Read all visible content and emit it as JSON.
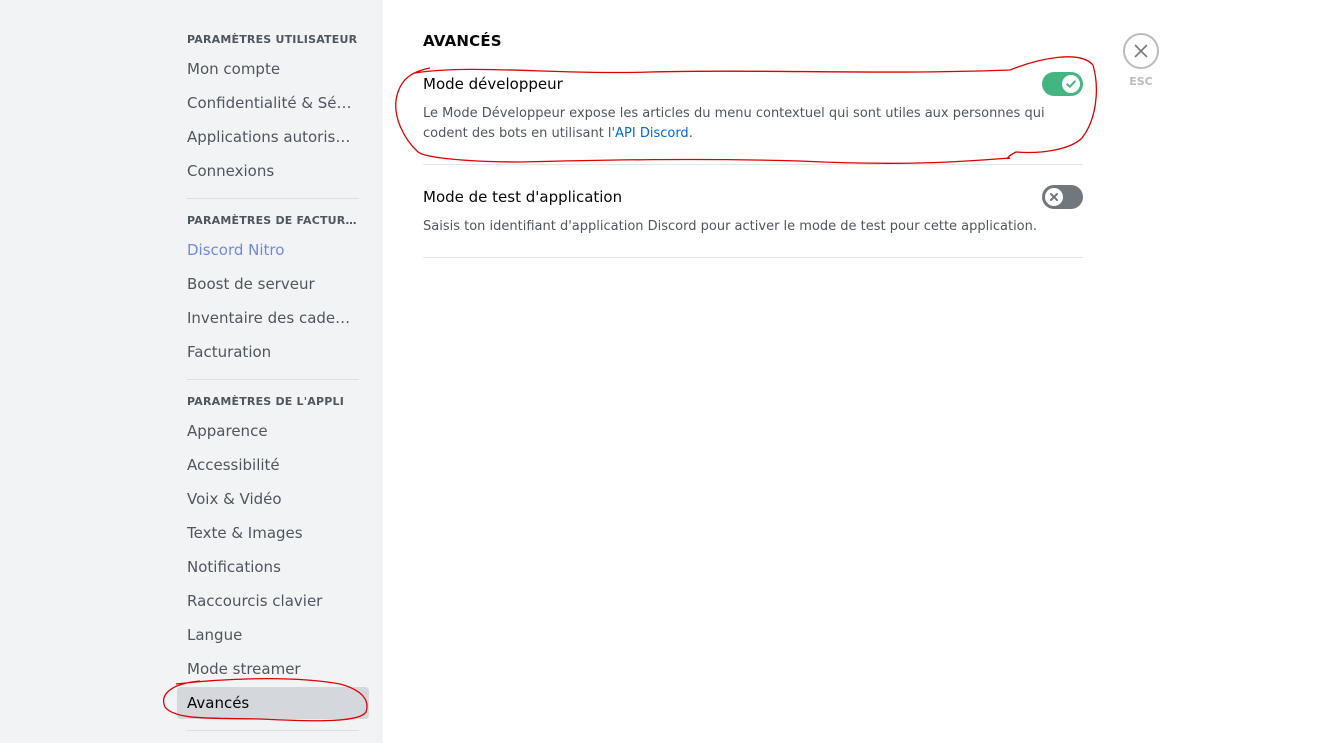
{
  "sidebar": {
    "sections": [
      {
        "header": "PARAMÈTRES UTILISATEUR",
        "items": [
          "Mon compte",
          "Confidentialité & Sécurité",
          "Applications autorisées",
          "Connexions"
        ]
      },
      {
        "header": "PARAMÈTRES DE FACTURATION",
        "items": [
          "Discord Nitro",
          "Boost de serveur",
          "Inventaire des cadeaux",
          "Facturation"
        ]
      },
      {
        "header": "PARAMÈTRES DE L'APPLI",
        "items": [
          "Apparence",
          "Accessibilité",
          "Voix & Vidéo",
          "Texte & Images",
          "Notifications",
          "Raccourcis clavier",
          "Langue",
          "Mode streamer",
          "Avancés"
        ]
      }
    ],
    "selected_item": "Avancés"
  },
  "main": {
    "title": "AVANCÉS",
    "settings": [
      {
        "title": "Mode développeur",
        "description_prefix": "Le Mode Développeur expose les articles du menu contextuel qui sont utiles aux personnes qui codent des bots en utilisant l'",
        "link_text": "API Discord",
        "description_suffix": ".",
        "enabled": true
      },
      {
        "title": "Mode de test d'application",
        "description": "Saisis ton identifiant d'application Discord pour activer le mode de test pour cette application.",
        "enabled": false
      }
    ]
  },
  "close": {
    "label": "ESC"
  },
  "colors": {
    "toggle_on": "#43b581",
    "toggle_off": "#72767d",
    "link": "#0068e0",
    "brand": "#7289da",
    "annotation": "#e00000"
  },
  "icons": {
    "close": "close-icon",
    "check": "check-icon",
    "x": "x-icon"
  }
}
